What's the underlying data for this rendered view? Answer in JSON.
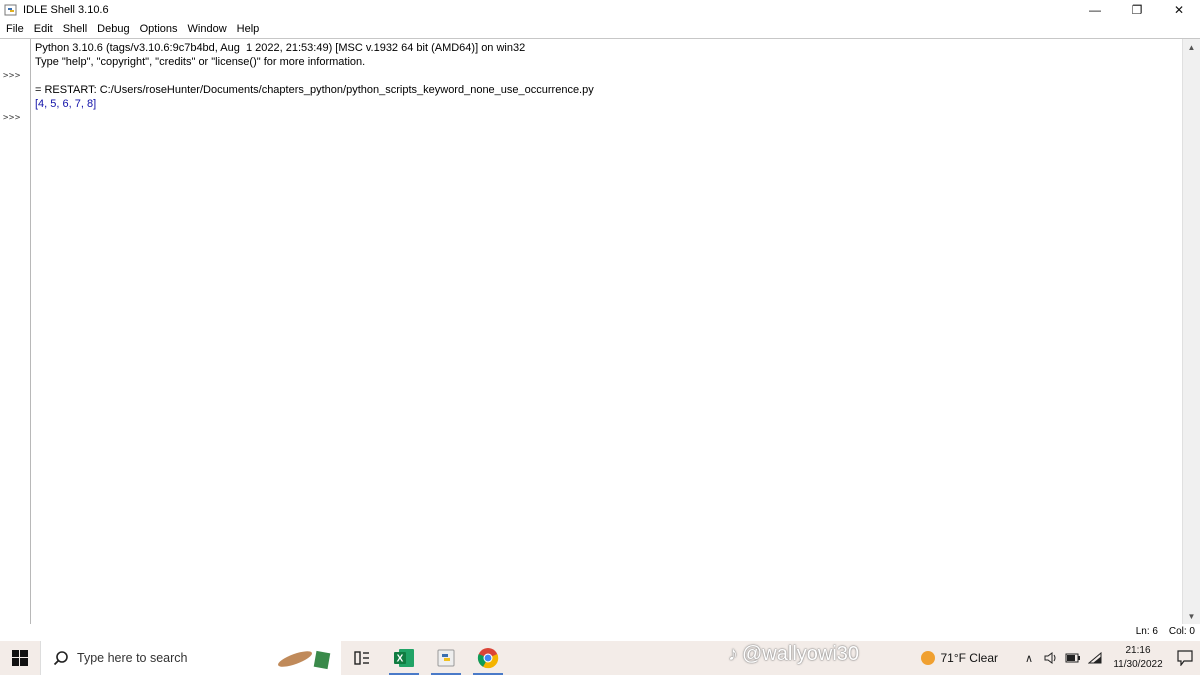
{
  "window": {
    "title": "IDLE Shell 3.10.6",
    "controls": {
      "minimize": "—",
      "restore": "❐",
      "close": "✕"
    }
  },
  "menu": [
    "File",
    "Edit",
    "Shell",
    "Debug",
    "Options",
    "Window",
    "Help"
  ],
  "shell": {
    "prompt": ">>>",
    "lines": [
      "Python 3.10.6 (tags/v3.10.6:9c7b4bd, Aug  1 2022, 21:53:49) [MSC v.1932 64 bit (AMD64)] on win32",
      "Type \"help\", \"copyright\", \"credits\" or \"license()\" for more information.",
      "= RESTART: C:/Users/roseHunter/Documents/chapters_python/python_scripts_keyword_none_use_occurrence.py",
      "[4, 5, 6, 7, 8]"
    ]
  },
  "status": {
    "ln": "Ln: 6",
    "col": "Col: 0"
  },
  "taskbar": {
    "search_placeholder": "Type here to search",
    "watermark": "@wallyowi30",
    "weather": "71°F  Clear",
    "time": "21:16",
    "date": "11/30/2022",
    "tray_chevron": "∧"
  },
  "colors": {
    "output_blue": "#1010a8",
    "taskbar_bg": "#f3ece8"
  }
}
